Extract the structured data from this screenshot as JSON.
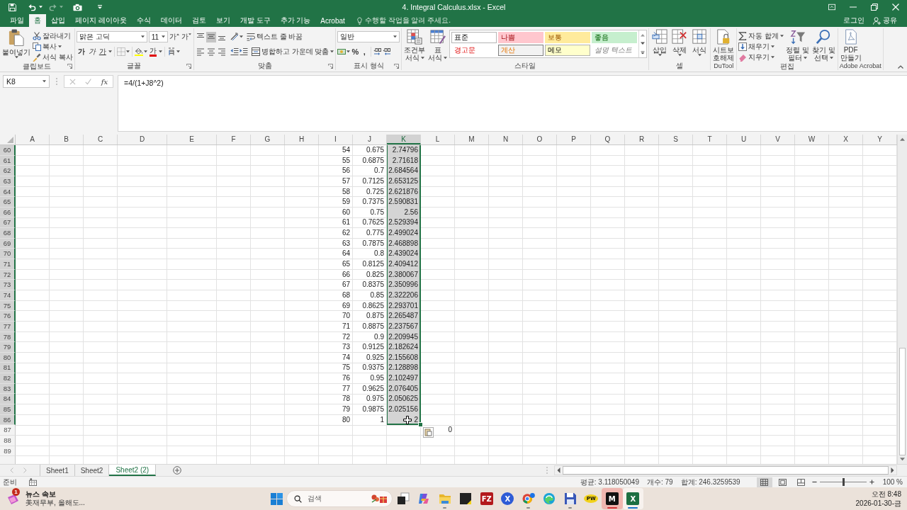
{
  "title_bar": {
    "title": "4. Integral Calculus.xlsx - Excel",
    "quick_access": [
      {
        "kind": "save",
        "disabled": false
      },
      {
        "kind": "undo",
        "disabled": false
      },
      {
        "kind": "redo",
        "disabled": true
      },
      {
        "kind": "camera",
        "disabled": false
      },
      {
        "kind": "customize",
        "disabled": false
      }
    ]
  },
  "ribbon_tabs": [
    {
      "label": "파일",
      "selected": false
    },
    {
      "label": "홈",
      "selected": true
    },
    {
      "label": "삽입",
      "selected": false
    },
    {
      "label": "페이지 레이아웃",
      "selected": false
    },
    {
      "label": "수식",
      "selected": false
    },
    {
      "label": "데이터",
      "selected": false
    },
    {
      "label": "검토",
      "selected": false
    },
    {
      "label": "보기",
      "selected": false
    },
    {
      "label": "개발 도구",
      "selected": false
    },
    {
      "label": "추가 기능",
      "selected": false
    },
    {
      "label": "Acrobat",
      "selected": false
    }
  ],
  "tell_me": {
    "placeholder": "수행할 작업을 알려 주세요."
  },
  "account": {
    "sign_in": "로그인",
    "share": "공유"
  },
  "ribbon_groups": [
    {
      "kind": "clipboard",
      "label": "클립보드",
      "paste": "붙여넣기",
      "cut": "잘라내기",
      "copy": "복사",
      "format_painter": "서식 복사"
    },
    {
      "kind": "font",
      "label": "글꼴",
      "font": "맑은 고딕",
      "size": "11",
      "grow": "가",
      "shrink": "가",
      "bold": "가",
      "italic": "가",
      "underline": "가",
      "font_color": "가"
    },
    {
      "kind": "alignment",
      "label": "맞춤",
      "vertical": [
        {
          "kind": "top",
          "selected": false
        },
        {
          "kind": "middle",
          "selected": true
        },
        {
          "kind": "bottom",
          "selected": false
        }
      ],
      "horizontal": [
        {
          "kind": "left",
          "selected": false
        },
        {
          "kind": "center",
          "selected": false
        },
        {
          "kind": "right",
          "selected": false
        }
      ],
      "wrap_text": "텍스트 줄 바꿈",
      "merge": "병합하고 가운데 맞춤"
    },
    {
      "kind": "number",
      "label": "표시 형식",
      "format": "일반",
      "percent": "%",
      "comma": ","
    },
    {
      "kind": "styles",
      "label": "스타일",
      "conditional": [
        "조건부",
        "서식"
      ],
      "table": [
        "표",
        "서식"
      ],
      "cell_styles": [
        {
          "label": "표준",
          "kind": "normal",
          "color": "#ffffff"
        },
        {
          "label": "나쁨",
          "kind": "bad",
          "color": "#ffc7ce"
        },
        {
          "label": "보통",
          "kind": "neutral",
          "color": "#ffeb9c"
        },
        {
          "label": "좋음",
          "kind": "good",
          "color": "#c6efce"
        },
        {
          "label": "경고문",
          "kind": "warning",
          "color": "#ffffff"
        },
        {
          "label": "계산",
          "kind": "calculation",
          "color": "#f2f2f2"
        },
        {
          "label": "메모",
          "kind": "note",
          "color": "#ffffcc"
        },
        {
          "label": "설명 텍스트",
          "kind": "explanatory",
          "color": "#ffffff"
        }
      ]
    },
    {
      "kind": "cells",
      "label": "셀",
      "insert": "삽입",
      "delete": "삭제",
      "format": "서식"
    },
    {
      "kind": "dutool",
      "label": "DuTool",
      "unprotect": [
        "시트보",
        "호해제"
      ]
    },
    {
      "kind": "editing",
      "label": "편집",
      "autosum": "자동 합계",
      "fill": "채우기",
      "clear": "지우기",
      "sort": [
        "정렬 및",
        "필터"
      ],
      "find": [
        "찾기 및",
        "선택"
      ]
    },
    {
      "kind": "acrobat",
      "label": "Adobe Acrobat",
      "create_pdf": [
        "PDF",
        "만들기"
      ]
    }
  ],
  "formula_bar": {
    "name_box": "K8",
    "edit_disabled": true,
    "function_label": "fx",
    "formula": "=4/(1+J8^2)"
  },
  "sheet": {
    "columns": [
      {
        "label": "A",
        "selected": false
      },
      {
        "label": "B",
        "selected": false
      },
      {
        "label": "C",
        "selected": false
      },
      {
        "label": "D",
        "selected": false
      },
      {
        "label": "E",
        "selected": false
      },
      {
        "label": "F",
        "selected": false
      },
      {
        "label": "G",
        "selected": false
      },
      {
        "label": "H",
        "selected": false
      },
      {
        "label": "I",
        "selected": false
      },
      {
        "label": "J",
        "selected": false
      },
      {
        "label": "K",
        "selected": true
      },
      {
        "label": "L",
        "selected": false
      },
      {
        "label": "M",
        "selected": false
      },
      {
        "label": "N",
        "selected": false
      },
      {
        "label": "O",
        "selected": false
      },
      {
        "label": "P",
        "selected": false
      },
      {
        "label": "Q",
        "selected": false
      },
      {
        "label": "R",
        "selected": false
      },
      {
        "label": "S",
        "selected": false
      },
      {
        "label": "T",
        "selected": false
      },
      {
        "label": "U",
        "selected": false
      },
      {
        "label": "V",
        "selected": false
      },
      {
        "label": "W",
        "selected": false
      },
      {
        "label": "X",
        "selected": false
      },
      {
        "label": "Y",
        "selected": false
      }
    ],
    "rows": [
      {
        "header": "60",
        "selected": true,
        "i": "54",
        "j": "0.675",
        "k": "2.74796"
      },
      {
        "header": "61",
        "selected": true,
        "i": "55",
        "j": "0.6875",
        "k": "2.71618"
      },
      {
        "header": "62",
        "selected": true,
        "i": "56",
        "j": "0.7",
        "k": "2.684564"
      },
      {
        "header": "63",
        "selected": true,
        "i": "57",
        "j": "0.7125",
        "k": "2.653125"
      },
      {
        "header": "64",
        "selected": true,
        "i": "58",
        "j": "0.725",
        "k": "2.621876"
      },
      {
        "header": "65",
        "selected": true,
        "i": "59",
        "j": "0.7375",
        "k": "2.590831"
      },
      {
        "header": "66",
        "selected": true,
        "i": "60",
        "j": "0.75",
        "k": "2.56"
      },
      {
        "header": "67",
        "selected": true,
        "i": "61",
        "j": "0.7625",
        "k": "2.529394"
      },
      {
        "header": "68",
        "selected": true,
        "i": "62",
        "j": "0.775",
        "k": "2.499024"
      },
      {
        "header": "69",
        "selected": true,
        "i": "63",
        "j": "0.7875",
        "k": "2.468898"
      },
      {
        "header": "70",
        "selected": true,
        "i": "64",
        "j": "0.8",
        "k": "2.439024"
      },
      {
        "header": "71",
        "selected": true,
        "i": "65",
        "j": "0.8125",
        "k": "2.409412"
      },
      {
        "header": "72",
        "selected": true,
        "i": "66",
        "j": "0.825",
        "k": "2.380067"
      },
      {
        "header": "73",
        "selected": true,
        "i": "67",
        "j": "0.8375",
        "k": "2.350996"
      },
      {
        "header": "74",
        "selected": true,
        "i": "68",
        "j": "0.85",
        "k": "2.322206"
      },
      {
        "header": "75",
        "selected": true,
        "i": "69",
        "j": "0.8625",
        "k": "2.293701"
      },
      {
        "header": "76",
        "selected": true,
        "i": "70",
        "j": "0.875",
        "k": "2.265487"
      },
      {
        "header": "77",
        "selected": true,
        "i": "71",
        "j": "0.8875",
        "k": "2.237567"
      },
      {
        "header": "78",
        "selected": true,
        "i": "72",
        "j": "0.9",
        "k": "2.209945"
      },
      {
        "header": "79",
        "selected": true,
        "i": "73",
        "j": "0.9125",
        "k": "2.182624"
      },
      {
        "header": "80",
        "selected": true,
        "i": "74",
        "j": "0.925",
        "k": "2.155608"
      },
      {
        "header": "81",
        "selected": true,
        "i": "75",
        "j": "0.9375",
        "k": "2.128898"
      },
      {
        "header": "82",
        "selected": true,
        "i": "76",
        "j": "0.95",
        "k": "2.102497"
      },
      {
        "header": "83",
        "selected": true,
        "i": "77",
        "j": "0.9625",
        "k": "2.076405"
      },
      {
        "header": "84",
        "selected": true,
        "i": "78",
        "j": "0.975",
        "k": "2.050625"
      },
      {
        "header": "85",
        "selected": true,
        "i": "79",
        "j": "0.9875",
        "k": "2.025156"
      },
      {
        "header": "86",
        "selected": true,
        "i": "80",
        "j": "1",
        "k": "2"
      },
      {
        "header": "87",
        "selected": false,
        "l": "0"
      },
      {
        "header": "88",
        "selected": false
      },
      {
        "header": "89",
        "selected": false
      }
    ]
  },
  "sheet_tabs": [
    {
      "label": "Sheet1",
      "selected": false
    },
    {
      "label": "Sheet2",
      "selected": false
    },
    {
      "label": "Sheet2 (2)",
      "selected": true
    }
  ],
  "status_bar": {
    "mode": "준비",
    "average": "평균: 3.118050049",
    "count": "개수: 79",
    "sum": "합계: 246.3259539",
    "views": [
      {
        "kind": "normal",
        "selected": true
      },
      {
        "kind": "page-layout",
        "selected": false
      },
      {
        "kind": "page-break",
        "selected": false
      }
    ],
    "zoom": {
      "level": 0.5,
      "label": "100 %"
    }
  },
  "taskbar": {
    "news": {
      "badge": "1",
      "title": "뉴스 속보",
      "headline": "美재무부, 올해도..."
    },
    "search": {
      "placeholder": "검색"
    },
    "apps": [
      {
        "kind": "task-view",
        "running": false,
        "selected": false,
        "flashing": false
      },
      {
        "kind": "assistant",
        "running": false,
        "selected": false,
        "flashing": false
      },
      {
        "kind": "folder",
        "running": true,
        "selected": false,
        "flashing": false
      },
      {
        "kind": "note",
        "running": false,
        "selected": false,
        "flashing": false
      },
      {
        "kind": "tile",
        "label": "FZ",
        "color": "#b3191c",
        "running": false,
        "selected": false,
        "flashing": false
      },
      {
        "kind": "round",
        "label": "X",
        "color": "#2e5bd6",
        "running": false,
        "selected": false,
        "flashing": false
      },
      {
        "kind": "browser",
        "running": true,
        "selected": false,
        "flashing": false
      },
      {
        "kind": "wave",
        "running": false,
        "selected": false,
        "flashing": false
      },
      {
        "kind": "disk",
        "running": true,
        "selected": false,
        "flashing": false
      },
      {
        "kind": "oval",
        "label": "PW",
        "color": "#f2d21b",
        "running": false,
        "selected": false,
        "flashing": false
      },
      {
        "kind": "tile",
        "label": "M",
        "color": "#111111",
        "running": true,
        "selected": false,
        "flashing": true
      },
      {
        "kind": "tile",
        "label": "X",
        "color": "#1d6f42",
        "running": true,
        "selected": true,
        "flashing": false
      }
    ],
    "clock": {
      "time": "오전 8:48",
      "date": "2026-01-30-금"
    }
  }
}
